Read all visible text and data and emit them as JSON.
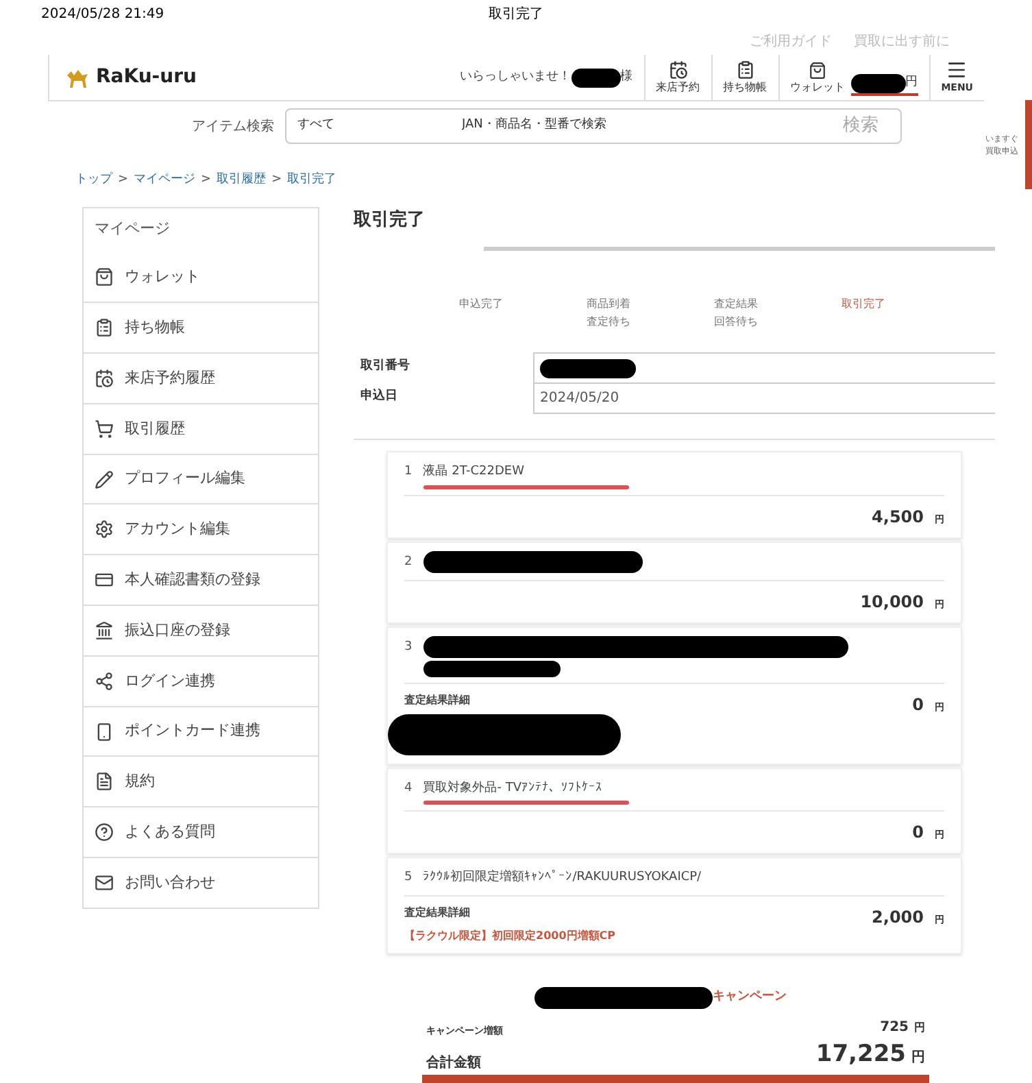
{
  "status_bar": {
    "time": "2024/05/28 21:49",
    "title": "取引完了"
  },
  "top_links": [
    "ご利用ガイド",
    "買取に出す前に"
  ],
  "header": {
    "logo": "RaKu-uru",
    "greeting": "いらっしゃいませ！",
    "greeting_redacted": true,
    "honorific": "様",
    "nav": [
      {
        "label": "来店予約"
      },
      {
        "label": "持ち物帳"
      }
    ],
    "wallet": {
      "label": "ウォレット",
      "redacted": true,
      "unit": "円"
    },
    "menu": "MENU"
  },
  "search": {
    "label": "アイテム検索",
    "category": "すべて",
    "placeholder": "JAN・商品名・型番で検索",
    "button": "検索"
  },
  "side_tab": "いますぐ買取申込",
  "breadcrumb": {
    "separator": ">",
    "links": [
      "トップ",
      "マイページ",
      "取引履歴",
      "取引完了"
    ]
  },
  "sidebar": {
    "title": "マイページ",
    "items": [
      {
        "label": "ウォレット"
      },
      {
        "label": "持ち物帳"
      },
      {
        "label": "来店予約履歴"
      },
      {
        "label": "取引履歴"
      },
      {
        "label": "プロフィール編集"
      },
      {
        "label": "アカウント編集"
      },
      {
        "label": "本人確認書類の登録"
      },
      {
        "label": "振込口座の登録"
      },
      {
        "label": "ログイン連携"
      },
      {
        "label": "ポイントカード連携"
      },
      {
        "label": "規約"
      },
      {
        "label": "よくある質問"
      },
      {
        "label": "お問い合わせ"
      }
    ]
  },
  "page_title": "取引完了",
  "steps": [
    {
      "lines": [
        "申込完了"
      ],
      "selected": false
    },
    {
      "lines": [
        "商品到着",
        "査定待ち"
      ],
      "selected": false
    },
    {
      "lines": [
        "査定結果",
        "回答待ち"
      ],
      "selected": false
    },
    {
      "lines": [
        "取引完了"
      ],
      "selected": true
    }
  ],
  "info": [
    {
      "label": "取引番号",
      "redacted": true
    },
    {
      "label": "申込日",
      "value": "2024/05/20",
      "redacted": false
    }
  ],
  "items": [
    {
      "no": "1",
      "name": "液晶 2T-C22DEW",
      "redacted": false,
      "underlined": true,
      "price": "4,500",
      "unit": "円"
    },
    {
      "no": "2",
      "redacted": true,
      "underlined": false,
      "price": "10,000",
      "unit": "円"
    },
    {
      "no": "3",
      "redacted": true,
      "underlined": false,
      "detail_label": "査定結果詳細",
      "detail_redacted": true,
      "price": "0",
      "unit": "円"
    },
    {
      "no": "4",
      "name": "買取対象外品- TVｱﾝﾃﾅ、ｿﾌﾄｹｰｽ",
      "redacted": false,
      "underlined": true,
      "price": "0",
      "unit": "円"
    },
    {
      "no": "5",
      "name": "ﾗｸｳﾙ初回限定増額ｷｬﾝﾍﾟｰﾝ/RAKUURUSYOKAICP/",
      "redacted": false,
      "underlined": false,
      "detail_label": "査定結果詳細",
      "detail_redacted": false,
      "note": "【ラクウル限定】初回限定2000円増額CP",
      "price": "2,000",
      "unit": "円"
    }
  ],
  "campaign": {
    "redacted": true,
    "title": "キャンペーン"
  },
  "summary": [
    {
      "label": "キャンペーン増額",
      "value": "725",
      "unit": "円",
      "kind": "sub"
    },
    {
      "label": "合計金額",
      "value": "17,225",
      "unit": "円",
      "kind": "total"
    }
  ]
}
